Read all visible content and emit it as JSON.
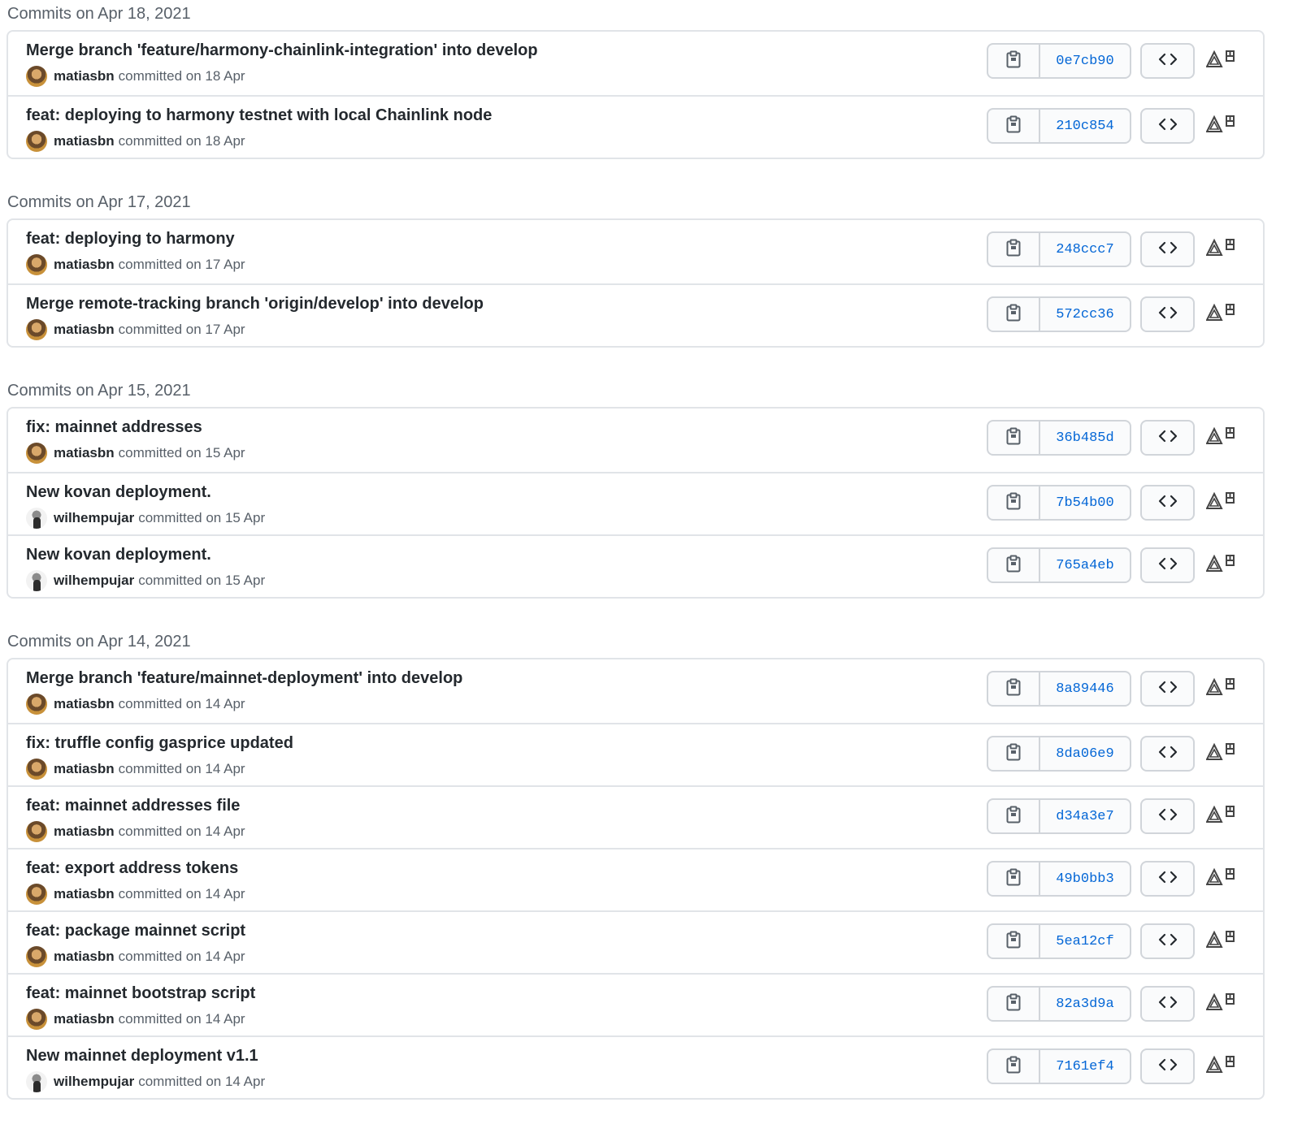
{
  "groups": [
    {
      "heading": "Commits on Apr 18, 2021",
      "commits": [
        {
          "title": "Merge branch 'feature/harmony-chainlink-integration' into develop",
          "author": "matiasbn",
          "meta": "committed on 18 Apr",
          "sha": "0e7cb90",
          "avatar": "a1"
        },
        {
          "title": "feat: deploying to harmony testnet with local Chainlink node",
          "author": "matiasbn",
          "meta": "committed on 18 Apr",
          "sha": "210c854",
          "avatar": "a1"
        }
      ]
    },
    {
      "heading": "Commits on Apr 17, 2021",
      "commits": [
        {
          "title": "feat: deploying to harmony",
          "author": "matiasbn",
          "meta": "committed on 17 Apr",
          "sha": "248ccc7",
          "avatar": "a1"
        },
        {
          "title": "Merge remote-tracking branch 'origin/develop' into develop",
          "author": "matiasbn",
          "meta": "committed on 17 Apr",
          "sha": "572cc36",
          "avatar": "a1"
        }
      ]
    },
    {
      "heading": "Commits on Apr 15, 2021",
      "commits": [
        {
          "title": "fix: mainnet addresses",
          "author": "matiasbn",
          "meta": "committed on 15 Apr",
          "sha": "36b485d",
          "avatar": "a1"
        },
        {
          "title": "New kovan deployment.",
          "author": "wilhempujar",
          "meta": "committed on 15 Apr",
          "sha": "7b54b00",
          "avatar": "a2"
        },
        {
          "title": "New kovan deployment.",
          "author": "wilhempujar",
          "meta": "committed on 15 Apr",
          "sha": "765a4eb",
          "avatar": "a2"
        }
      ]
    },
    {
      "heading": "Commits on Apr 14, 2021",
      "commits": [
        {
          "title": "Merge branch 'feature/mainnet-deployment' into develop",
          "author": "matiasbn",
          "meta": "committed on 14 Apr",
          "sha": "8a89446",
          "avatar": "a1"
        },
        {
          "title": "fix: truffle config gasprice updated",
          "author": "matiasbn",
          "meta": "committed on 14 Apr",
          "sha": "8da06e9",
          "avatar": "a1"
        },
        {
          "title": "feat: mainnet addresses file",
          "author": "matiasbn",
          "meta": "committed on 14 Apr",
          "sha": "d34a3e7",
          "avatar": "a1"
        },
        {
          "title": "feat: export address tokens",
          "author": "matiasbn",
          "meta": "committed on 14 Apr",
          "sha": "49b0bb3",
          "avatar": "a1"
        },
        {
          "title": "feat: package mainnet script",
          "author": "matiasbn",
          "meta": "committed on 14 Apr",
          "sha": "5ea12cf",
          "avatar": "a1"
        },
        {
          "title": "feat: mainnet bootstrap script",
          "author": "matiasbn",
          "meta": "committed on 14 Apr",
          "sha": "82a3d9a",
          "avatar": "a1"
        },
        {
          "title": "New mainnet deployment v1.1",
          "author": "wilhempujar",
          "meta": "committed on 14 Apr",
          "sha": "7161ef4",
          "avatar": "a2"
        }
      ]
    }
  ],
  "icons": {
    "copy": "clipboard-icon",
    "browse": "code-brackets-icon",
    "extension": "extension-icon"
  },
  "colors": {
    "sha_link": "#0366d6",
    "border": "#e1e4e8",
    "muted_text": "#586069"
  }
}
